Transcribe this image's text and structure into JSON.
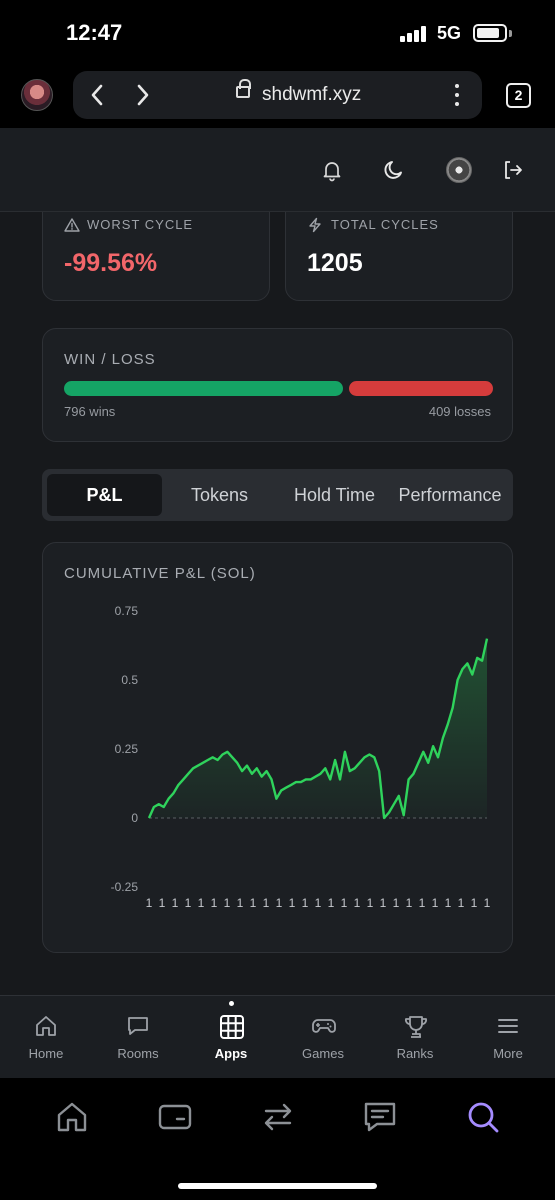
{
  "status_bar": {
    "time": "12:47",
    "network": "5G"
  },
  "browser": {
    "url": "shdwmf.xyz",
    "tab_count": "2"
  },
  "stats": {
    "worst_cycle": {
      "label": "WORST CYCLE",
      "value": "-99.56%"
    },
    "total_cycles": {
      "label": "TOTAL CYCLES",
      "value": "1205"
    }
  },
  "win_loss": {
    "title": "WIN / LOSS",
    "wins_text": "796 wins",
    "losses_text": "409 losses",
    "wins": 796,
    "losses": 409,
    "win_color": "#15a465",
    "loss_color": "#d53c3c"
  },
  "tabs": [
    {
      "label": "P&L",
      "active": true
    },
    {
      "label": "Tokens",
      "active": false
    },
    {
      "label": "Hold Time",
      "active": false
    },
    {
      "label": "Performance",
      "active": false
    }
  ],
  "chart_data": {
    "type": "area",
    "title": "CUMULATIVE P&L (SOL)",
    "xlabel": "",
    "ylabel": "",
    "ylim": [
      -0.25,
      0.75
    ],
    "yticks": [
      "0.75",
      "0.5",
      "0.25",
      "0",
      "-0.25"
    ],
    "xtick_label": "1",
    "xtick_count": 27,
    "line_color": "#2fd35c",
    "zero_line": true,
    "series": [
      {
        "values": [
          0.0,
          0.04,
          0.05,
          0.04,
          0.07,
          0.09,
          0.12,
          0.14,
          0.16,
          0.18,
          0.19,
          0.2,
          0.21,
          0.22,
          0.21,
          0.23,
          0.24,
          0.22,
          0.2,
          0.17,
          0.19,
          0.16,
          0.18,
          0.15,
          0.17,
          0.14,
          0.07,
          0.1,
          0.11,
          0.12,
          0.13,
          0.13,
          0.14,
          0.14,
          0.15,
          0.16,
          0.18,
          0.14,
          0.21,
          0.14,
          0.24,
          0.17,
          0.18,
          0.2,
          0.22,
          0.23,
          0.22,
          0.17,
          0.0,
          0.02,
          0.05,
          0.08,
          0.01,
          0.14,
          0.16,
          0.2,
          0.24,
          0.2,
          0.26,
          0.22,
          0.29,
          0.34,
          0.4,
          0.5,
          0.54,
          0.56,
          0.52,
          0.58,
          0.57,
          0.65
        ]
      }
    ]
  },
  "app_nav": [
    {
      "label": "Home",
      "icon": "home-icon"
    },
    {
      "label": "Rooms",
      "icon": "chat-icon"
    },
    {
      "label": "Apps",
      "icon": "grid-icon",
      "active": true
    },
    {
      "label": "Games",
      "icon": "gamepad-icon"
    },
    {
      "label": "Ranks",
      "icon": "trophy-icon"
    },
    {
      "label": "More",
      "icon": "menu-icon"
    }
  ],
  "toolbar_icons": [
    "home-icon",
    "wallet-icon",
    "swap-icon",
    "message-icon",
    "search-icon"
  ],
  "accent": "#a58cff"
}
